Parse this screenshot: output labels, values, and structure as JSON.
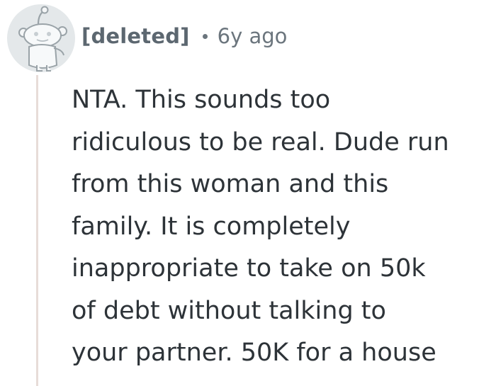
{
  "comment": {
    "author": "[deleted]",
    "separator": "•",
    "age": "6y ago",
    "body_lines": [
      "NTA. This sounds too",
      "ridiculous to be real. Dude run",
      "from this woman and this",
      "family. It is completely",
      "inappropriate to take on 50k",
      "of debt without talking to",
      "your partner. 50K for a house"
    ]
  },
  "colors": {
    "author": "#5c6770",
    "meta": "#6b757d",
    "body": "#2d3338",
    "thread_line": "#e7dcd8",
    "avatar_bg": "#e4e8ea"
  },
  "icons": {
    "avatar": "snoo-avatar-icon"
  }
}
